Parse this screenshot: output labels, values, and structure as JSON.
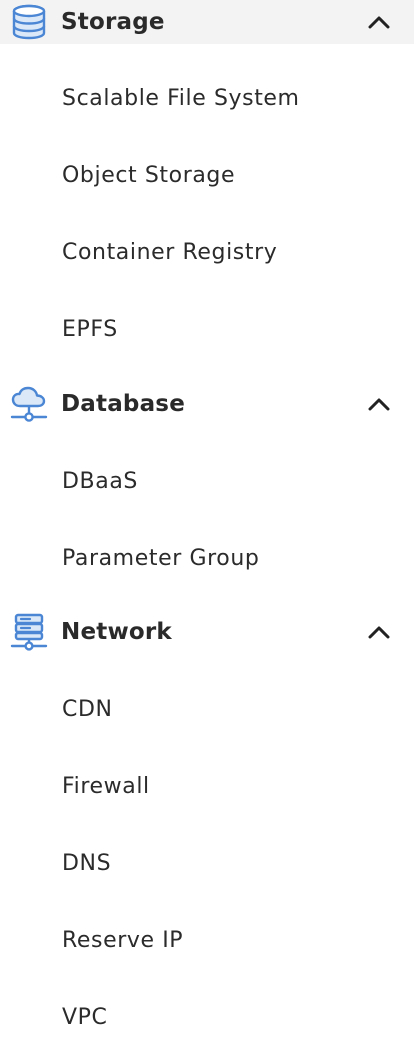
{
  "sidebar": {
    "storage": {
      "label": "Storage",
      "icon": "database-icon",
      "expanded": true,
      "items": [
        "Scalable File System",
        "Object Storage",
        "Container Registry",
        "EPFS"
      ]
    },
    "database": {
      "label": "Database",
      "icon": "cloud-network-icon",
      "expanded": true,
      "items": [
        "DBaaS",
        "Parameter Group"
      ]
    },
    "network": {
      "label": "Network",
      "icon": "server-network-icon",
      "expanded": true,
      "items": [
        "CDN",
        "Firewall",
        "DNS",
        "Reserve IP",
        "VPC"
      ]
    },
    "colors": {
      "icon_blue": "#4a86d4",
      "active_bg": "#f3f3f3",
      "text": "#2b2b2b"
    }
  }
}
